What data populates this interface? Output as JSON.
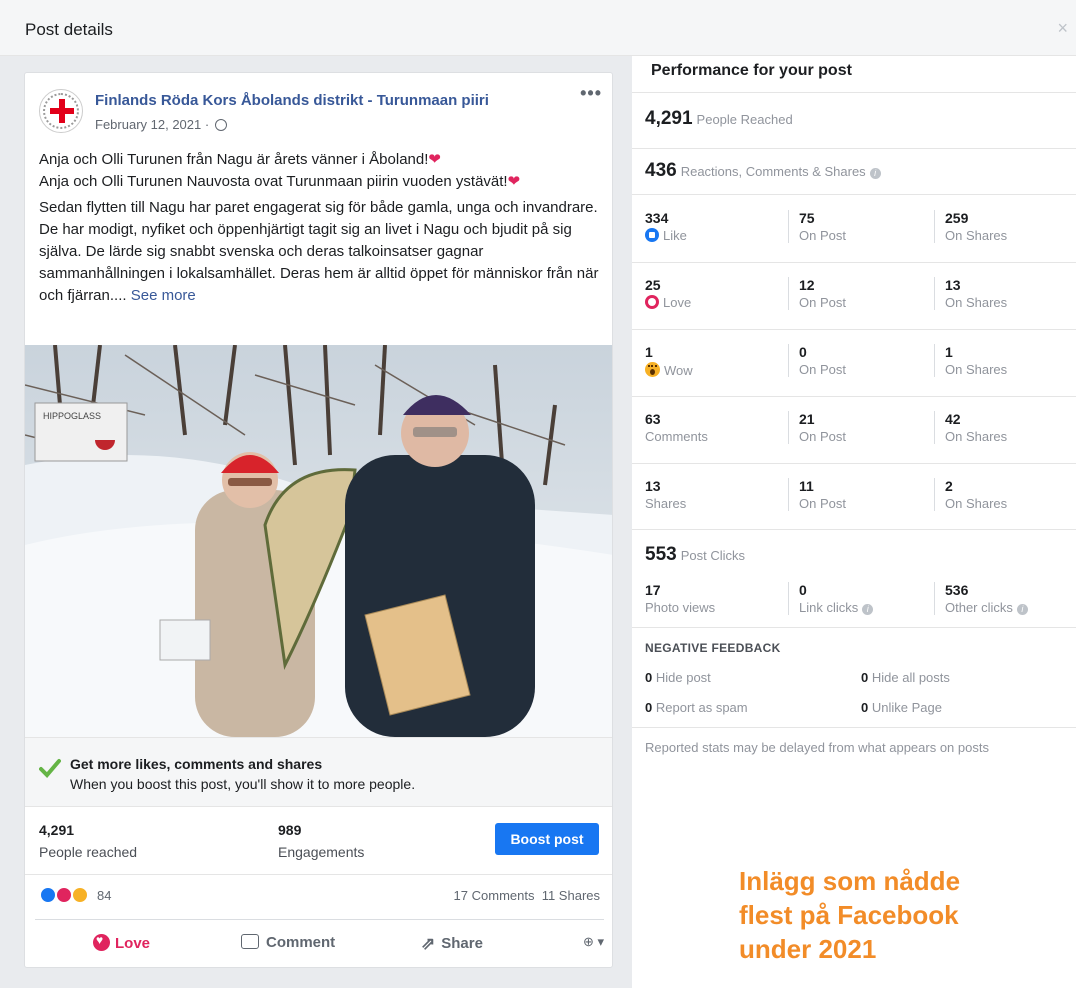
{
  "modal": {
    "title": "Post details",
    "close_glyph": "×"
  },
  "post": {
    "page_name": "Finlands Röda Kors Åbolands distrikt - Turunmaan piiri",
    "date": "February 12, 2021 ·",
    "more_glyph": "•••",
    "text_line1": "Anja och Olli Turunen från Nagu är årets vänner i Åboland!",
    "text_line2": "Anja och Olli Turunen Nauvosta ovat Turunmaan piirin vuoden ystävät!",
    "heart": "❤",
    "body": "Sedan flytten till Nagu har paret engagerat sig för både gamla, unga och invandrare. De har modigt, nyfiket och öppenhjärtigt tagit sig an livet i Nagu och bjudit på sig själva. De lärde sig snabbt svenska och deras talkoinsatser gagnar sammanhållningen i lokalsamhället. Deras hem är alltid öppet för människor från när och fjärran....",
    "see_more": "See more",
    "photo_sign": "HIPPOGLASS"
  },
  "boost": {
    "title": "Get more likes, comments and shares",
    "desc": "When you boost this post, you'll show it to more people."
  },
  "stats": {
    "reached_num": "4,291",
    "reached_label": "People reached",
    "engagements_num": "989",
    "engagements_label": "Engagements",
    "boost_button": "Boost post"
  },
  "reactions": {
    "count": "84",
    "comments": "17 Comments",
    "shares": "11 Shares"
  },
  "actions": {
    "love": "Love",
    "comment": "Comment",
    "share": "Share",
    "share_glyph": "⇗",
    "audience_glyph": "⊕ ▾"
  },
  "performance": {
    "title": "Performance for your post",
    "people_reached_num": "4,291",
    "people_reached_label": "People Reached",
    "rcs_num": "436",
    "rcs_label": "Reactions, Comments & Shares",
    "info_glyph": "i",
    "rows": [
      {
        "c1n": "334",
        "c1l": "Like",
        "c2n": "75",
        "c2l": "On Post",
        "c3n": "259",
        "c3l": "On Shares"
      },
      {
        "c1n": "25",
        "c1l": "Love",
        "c2n": "12",
        "c2l": "On Post",
        "c3n": "13",
        "c3l": "On Shares"
      },
      {
        "c1n": "1",
        "c1l": "Wow",
        "c2n": "0",
        "c2l": "On Post",
        "c3n": "1",
        "c3l": "On Shares"
      },
      {
        "c1n": "63",
        "c1l": "Comments",
        "c2n": "21",
        "c2l": "On Post",
        "c3n": "42",
        "c3l": "On Shares"
      },
      {
        "c1n": "13",
        "c1l": "Shares",
        "c2n": "11",
        "c2l": "On Post",
        "c3n": "2",
        "c3l": "On Shares"
      }
    ],
    "post_clicks_num": "553",
    "post_clicks_label": "Post Clicks",
    "clicks": {
      "photo_n": "17",
      "photo_l": "Photo views",
      "link_n": "0",
      "link_l": "Link clicks",
      "other_n": "536",
      "other_l": "Other clicks"
    },
    "negative": {
      "title": "NEGATIVE FEEDBACK",
      "hide_post_n": "0",
      "hide_post_l": "Hide post",
      "hide_all_n": "0",
      "hide_all_l": "Hide all posts",
      "spam_n": "0",
      "spam_l": "Report as spam",
      "unlike_n": "0",
      "unlike_l": "Unlike Page"
    },
    "footnote": "Reported stats may be delayed from what appears on posts"
  },
  "caption": {
    "line1": "Inlägg som nådde",
    "line2": "flest på Facebook",
    "line3": "under 2021"
  },
  "colors": {
    "link": "#385898",
    "accent": "#1877f2",
    "love": "#e0245e",
    "caption": "#f28c28"
  }
}
